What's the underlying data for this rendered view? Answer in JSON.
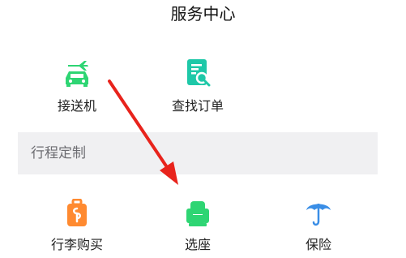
{
  "header": {
    "title": "服务中心"
  },
  "services_top": [
    {
      "label": "接送机",
      "icon": "car-plane-icon"
    },
    {
      "label": "查找订单",
      "icon": "order-search-icon"
    }
  ],
  "section": {
    "label": "行程定制"
  },
  "services_bottom": [
    {
      "label": "行李购买",
      "icon": "luggage-icon"
    },
    {
      "label": "选座",
      "icon": "seat-icon"
    },
    {
      "label": "保险",
      "icon": "umbrella-icon"
    }
  ],
  "colors": {
    "green": "#2ed573",
    "teal": "#1ec8a8",
    "orange": "#ff8a30",
    "blue": "#3a8ee6",
    "annotation_arrow": "#e8231c",
    "section_bg": "#f0f0f2"
  }
}
